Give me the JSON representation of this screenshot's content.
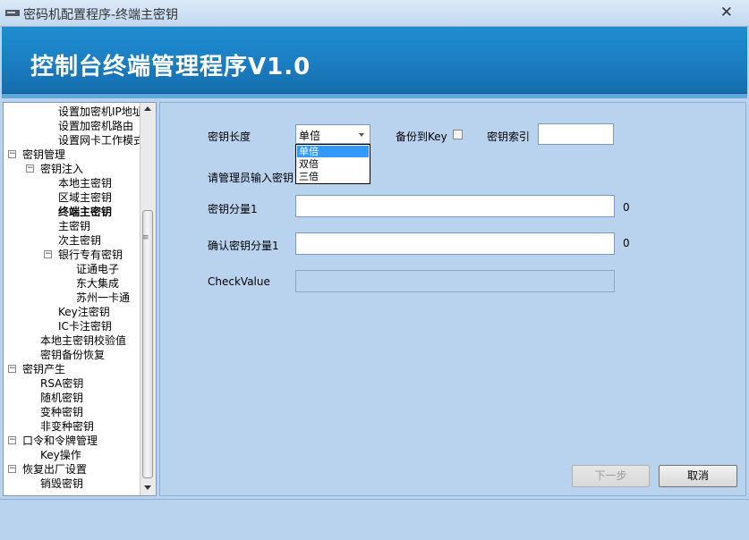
{
  "window": {
    "title": "密码机配置程序-终端主密钥",
    "close_glyph": "✕"
  },
  "banner": {
    "heading": "控制台终端管理程序V1.0"
  },
  "tree": {
    "items": [
      {
        "label": "设置加密机IP地址"
      },
      {
        "label": "设置加密机路由"
      },
      {
        "label": "设置网卡工作模式"
      },
      {
        "label": "密钥管理",
        "toggle": "−"
      },
      {
        "label": "密钥注入",
        "toggle": "−"
      },
      {
        "label": "本地主密钥"
      },
      {
        "label": "区域主密钥"
      },
      {
        "label": "终端主密钥"
      },
      {
        "label": "主密钥"
      },
      {
        "label": "次主密钥"
      },
      {
        "label": "银行专有密钥",
        "toggle": "−"
      },
      {
        "label": "证通电子"
      },
      {
        "label": "东大集成"
      },
      {
        "label": "苏州一卡通"
      },
      {
        "label": "Key注密钥"
      },
      {
        "label": "IC卡注密钥"
      },
      {
        "label": "本地主密钥校验值"
      },
      {
        "label": "密钥备份恢复"
      },
      {
        "label": "密钥产生",
        "toggle": "−"
      },
      {
        "label": "RSA密钥"
      },
      {
        "label": "随机密钥"
      },
      {
        "label": "变种密钥"
      },
      {
        "label": "非变种密钥"
      },
      {
        "label": "口令和令牌管理",
        "toggle": "−"
      },
      {
        "label": "Key操作"
      },
      {
        "label": "恢复出厂设置",
        "toggle": "−"
      },
      {
        "label": "销毁密钥"
      }
    ],
    "selected_index": 7
  },
  "form": {
    "key_length_label": "密钥长度",
    "key_length_value": "单倍",
    "key_length_options": [
      "单倍",
      "双倍",
      "三倍"
    ],
    "backup_label": "备份到Key",
    "backup_checked": false,
    "key_index_label": "密钥索引",
    "key_index_value": "",
    "admin_prompt_label": "请管理员输入密钥",
    "component_label": "密钥分量1",
    "component_value": "",
    "component_count": "0",
    "confirm_label": "确认密钥分量1",
    "confirm_value": "",
    "confirm_count": "0",
    "check_value_label": "CheckValue",
    "check_value": ""
  },
  "buttons": {
    "next_label": "下一步",
    "cancel_label": "取消"
  },
  "colors": {
    "banner": "#1b7fc3",
    "panel_background": "#b9d3ef",
    "selection": "#3399ff"
  }
}
